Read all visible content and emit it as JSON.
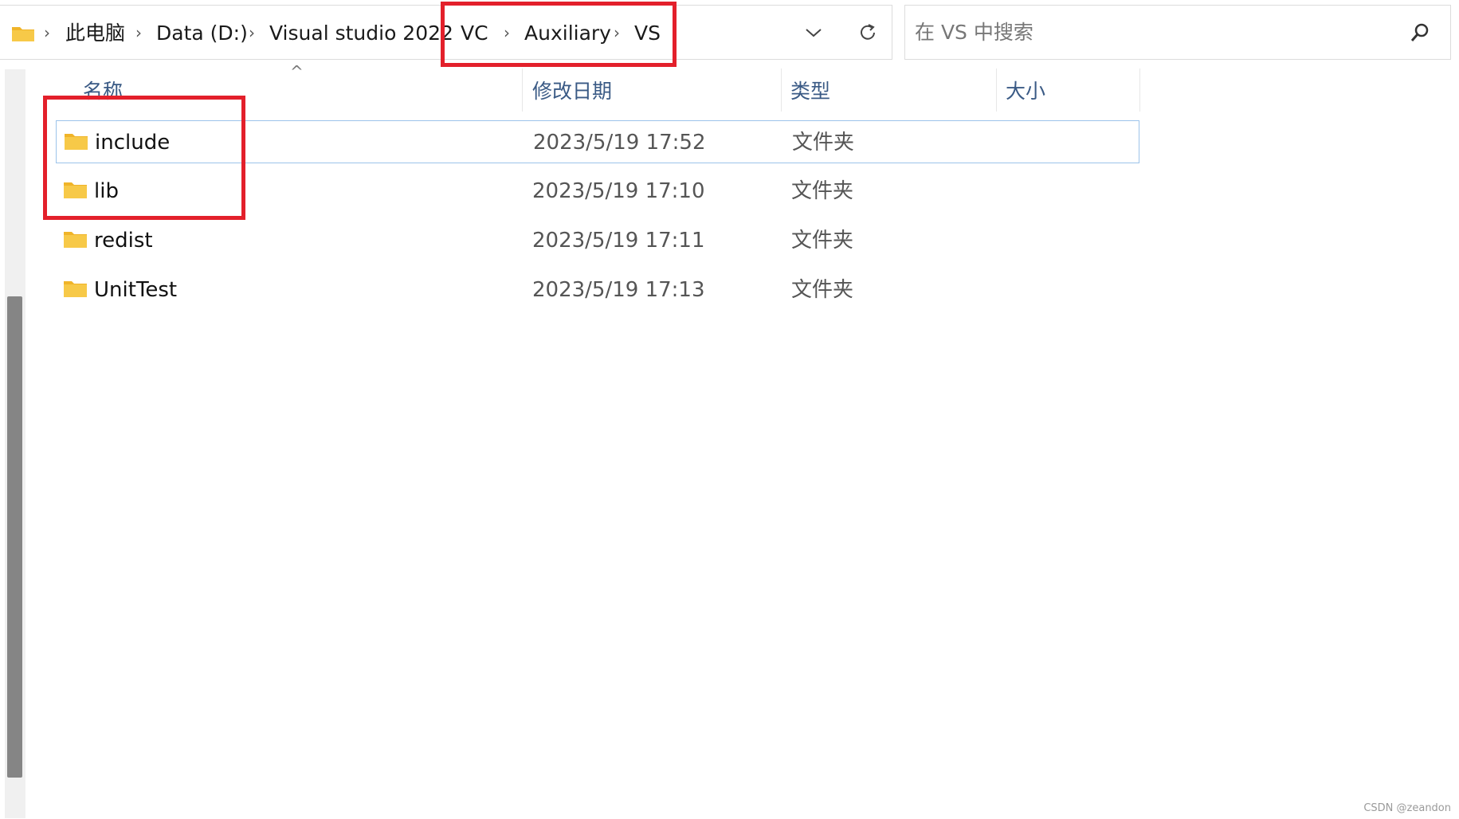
{
  "address_bar": {
    "crumbs": [
      "此电脑",
      "Data (D:)",
      "Visual studio 2022",
      "VC",
      "Auxiliary",
      "VS"
    ],
    "separator": "›",
    "dropdown_glyph": "∨",
    "refresh_glyph": "↻"
  },
  "search": {
    "placeholder": "在 VS 中搜索",
    "icon": "search-icon"
  },
  "columns": {
    "name": "名称",
    "date": "修改日期",
    "type": "类型",
    "size": "大小",
    "sort_glyph": "^"
  },
  "rows": [
    {
      "name": "include",
      "date": "2023/5/19 17:52",
      "type": "文件夹"
    },
    {
      "name": "lib",
      "date": "2023/5/19 17:10",
      "type": "文件夹"
    },
    {
      "name": "redist",
      "date": "2023/5/19 17:11",
      "type": "文件夹"
    },
    {
      "name": "UnitTest",
      "date": "2023/5/19 17:13",
      "type": "文件夹"
    }
  ],
  "watermark": "CSDN @zeandon",
  "colors": {
    "highlight": "#e3202b",
    "folder": "#f7c948",
    "selection_border": "#9cc3ea"
  }
}
